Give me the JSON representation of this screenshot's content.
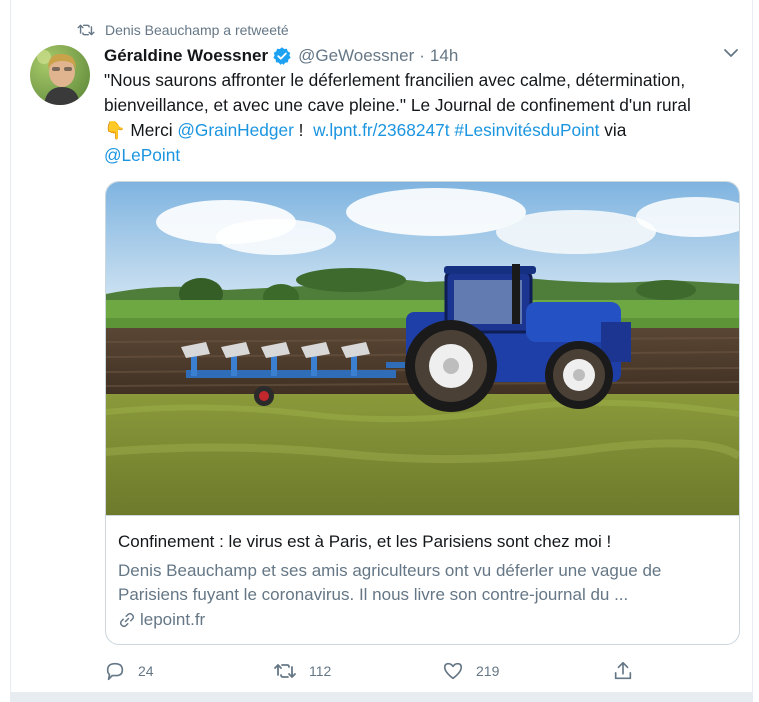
{
  "retweet": {
    "text": "Denis Beauchamp a retweeté",
    "icon": "retweet-icon"
  },
  "tweet": {
    "author_name": "Géraldine Woessner",
    "verified_icon": "verified-badge-icon",
    "handle": "@GeWoessner",
    "separator": "·",
    "time": "14h",
    "text_line1": "\"Nous saurons affronter le déferlement francilien avec calme, détermination,",
    "text_line2": "bienveillance, et avec une cave pleine.\" Le Journal de confinement d'un rural",
    "emoji": "👇",
    "merci": " Merci ",
    "mention1": "@GrainHedger",
    "excl": " !  ",
    "url": "w.lpnt.fr/2368247t",
    "space": " ",
    "hashtag": "#LesinvitésduPoint",
    "via": " via",
    "mention2": "@LePoint"
  },
  "card": {
    "title": "Confinement : le virus est à Paris, et les Parisiens sont chez moi !",
    "desc_line1": "Denis Beauchamp et ses amis agriculteurs ont vu déferler une vague de",
    "desc_line2": "Parisiens fuyant le coronavirus. Il nous livre son contre-journal du ...",
    "domain": "lepoint.fr"
  },
  "actions": {
    "reply_count": "24",
    "retweet_count": "112",
    "like_count": "219"
  },
  "colors": {
    "link": "#1b95e0",
    "text": "#14171a",
    "muted": "#657786",
    "tractor_blue": "#1f3fa8"
  }
}
